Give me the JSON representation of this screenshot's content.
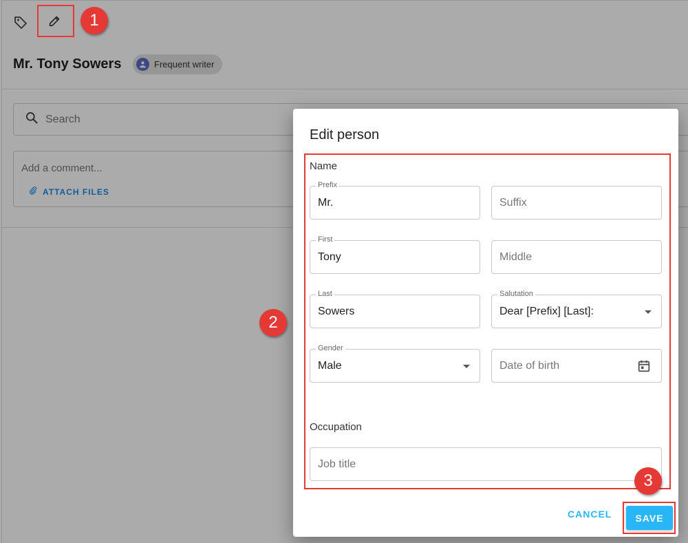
{
  "person": {
    "name": "Mr. Tony Sowers",
    "tag_chip": "Frequent writer"
  },
  "search": {
    "placeholder": "Search"
  },
  "comment": {
    "placeholder": "Add a comment...",
    "attach_label": "ATTACH FILES"
  },
  "dialog": {
    "title": "Edit person",
    "name_section": "Name",
    "fields": {
      "prefix": {
        "label": "Prefix",
        "value": "Mr."
      },
      "suffix": {
        "placeholder": "Suffix"
      },
      "first": {
        "label": "First",
        "value": "Tony"
      },
      "middle": {
        "placeholder": "Middle"
      },
      "last": {
        "label": "Last",
        "value": "Sowers"
      },
      "salutation": {
        "label": "Salutation",
        "value": "Dear [Prefix] [Last]:"
      },
      "gender": {
        "label": "Gender",
        "value": "Male"
      },
      "dob": {
        "placeholder": "Date of birth"
      }
    },
    "occupation_section": "Occupation",
    "job_title": {
      "placeholder": "Job title"
    },
    "cancel_label": "CANCEL",
    "save_label": "SAVE"
  },
  "callouts": [
    "1",
    "2",
    "3"
  ],
  "icons": [
    "tag-icon",
    "pencil-icon",
    "avatar-icon",
    "search-icon",
    "paperclip-icon",
    "calendar-icon",
    "dropdown-caret-icon"
  ],
  "colors": {
    "accent": "#29b6f6",
    "link": "#1e88e5",
    "callout": "#e53935"
  }
}
